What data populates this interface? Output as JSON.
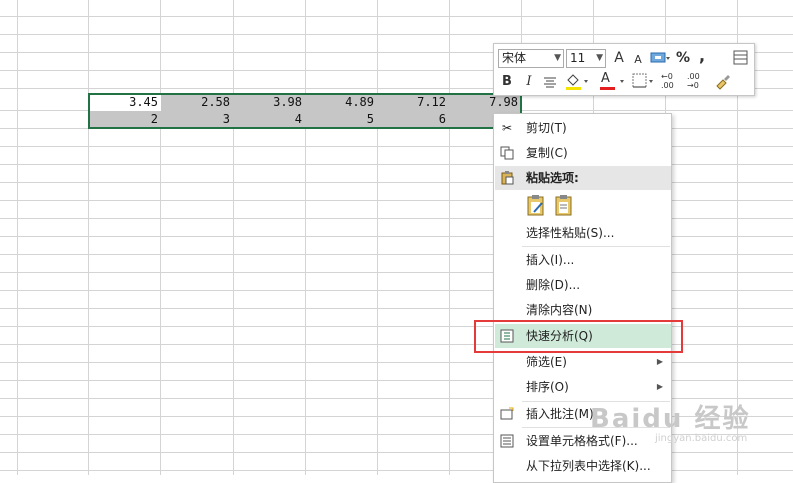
{
  "spreadsheet": {
    "row1": [
      "3.45",
      "2.58",
      "3.98",
      "4.89",
      "7.12",
      "7.98"
    ],
    "row2": [
      "2",
      "3",
      "4",
      "5",
      "6",
      ""
    ]
  },
  "mini_toolbar": {
    "font_name": "宋体",
    "font_size": "11",
    "grow_font": "A",
    "shrink_font": "A",
    "percent": "%",
    "comma": ",",
    "bold": "B",
    "italic": "I",
    "font_color": "A",
    "inc_decimal": "←0 .00",
    "dec_decimal": ".00 →0",
    "fill_color_hex": "#f5e400",
    "font_color_hex": "#e41e1e"
  },
  "context_menu": {
    "cut": "剪切(T)",
    "copy": "复制(C)",
    "paste_options": "粘贴选项:",
    "paste_special": "选择性粘贴(S)...",
    "insert": "插入(I)...",
    "delete": "删除(D)...",
    "clear": "清除内容(N)",
    "quick_analysis": "快速分析(Q)",
    "filter": "筛选(E)",
    "sort": "排序(O)",
    "insert_comment": "插入批注(M)",
    "format_cells": "设置单元格格式(F)...",
    "pick_from_list": "从下拉列表中选择(K)..."
  },
  "watermark": {
    "text": "Baidu 经验",
    "sub": "jingyan.baidu.com"
  }
}
